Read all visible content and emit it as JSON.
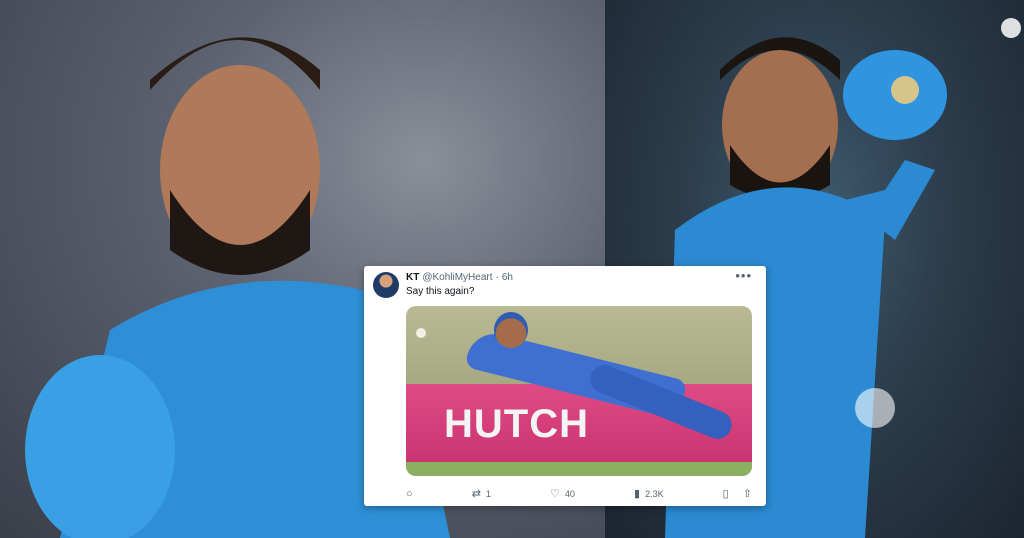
{
  "tweet": {
    "name": "KT",
    "handle": "@KohliMyHeart",
    "separator": "·",
    "time": "6h",
    "more_icon": "more-icon",
    "text": "Say this again?",
    "media": {
      "hoarding_text": "HUTCH"
    },
    "actions": {
      "reply": {
        "icon": "reply-icon",
        "count": ""
      },
      "retweet": {
        "icon": "retweet-icon",
        "count": "1"
      },
      "like": {
        "icon": "like-icon",
        "count": "40"
      },
      "views": {
        "icon": "views-icon",
        "count": "2.3K"
      },
      "bookmark": {
        "icon": "bookmark-icon"
      },
      "share": {
        "icon": "share-icon"
      }
    }
  }
}
